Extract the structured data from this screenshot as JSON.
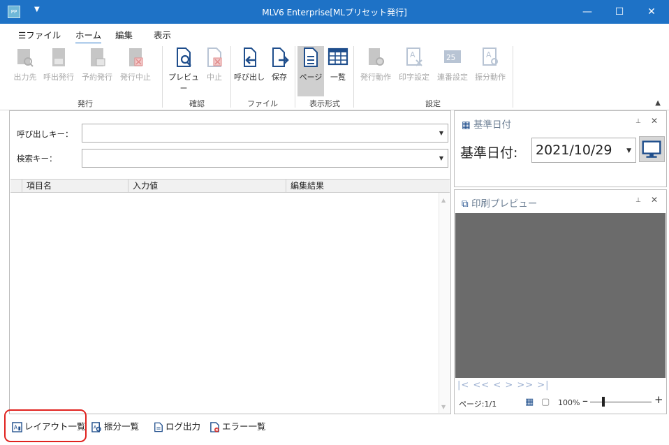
{
  "window": {
    "title": "MLV6 Enterprise[MLプリセット発行]",
    "app_icon_text": "PP",
    "minimize": "—",
    "maximize": "☐",
    "close": "✕"
  },
  "menu": {
    "file": "☰ファイル",
    "home": "ホーム",
    "edit": "編集",
    "view": "表示"
  },
  "ribbon": {
    "buttons": {
      "output_dest": "出力先",
      "recall_issue": "呼出発行",
      "reserve_issue": "予約発行",
      "issue_stop": "発行中止",
      "preview": "プレビュー",
      "stop": "中止",
      "recall": "呼び出し",
      "save": "保存",
      "page": "ページ",
      "list": "一覧",
      "issue_action": "発行動作",
      "print_settings": "印字設定",
      "serial_settings": "連番設定",
      "sort_action": "振分動作"
    },
    "groups": {
      "issue": "発行",
      "confirm": "確認",
      "file": "ファイル",
      "display_format": "表示形式",
      "settings": "設定"
    }
  },
  "form": {
    "recall_key_label": "呼び出しキー：",
    "search_key_label": "検索キー：",
    "recall_key_value": "",
    "search_key_value": ""
  },
  "grid": {
    "columns": [
      "項目名",
      "入力値",
      "編集結果"
    ]
  },
  "base_date_panel": {
    "title": "基準日付",
    "label": "基準日付:",
    "value": "2021/10/29"
  },
  "preview_panel": {
    "title": "印刷プレビュー",
    "nav": "|<  <<  <  >  >>  >|",
    "page_info": "ページ:1/1",
    "zoom": "100%",
    "zoom_level": 0.2
  },
  "bottom_tabs": {
    "layout_list": "レイアウト一覧",
    "sort_list": "振分一覧",
    "log_output": "ログ出力",
    "error_list": "エラー一覧"
  },
  "colors": {
    "titlebar": "#1e72c6",
    "highlight": "#e0231f",
    "accent_icon": "#1f4e8c"
  }
}
